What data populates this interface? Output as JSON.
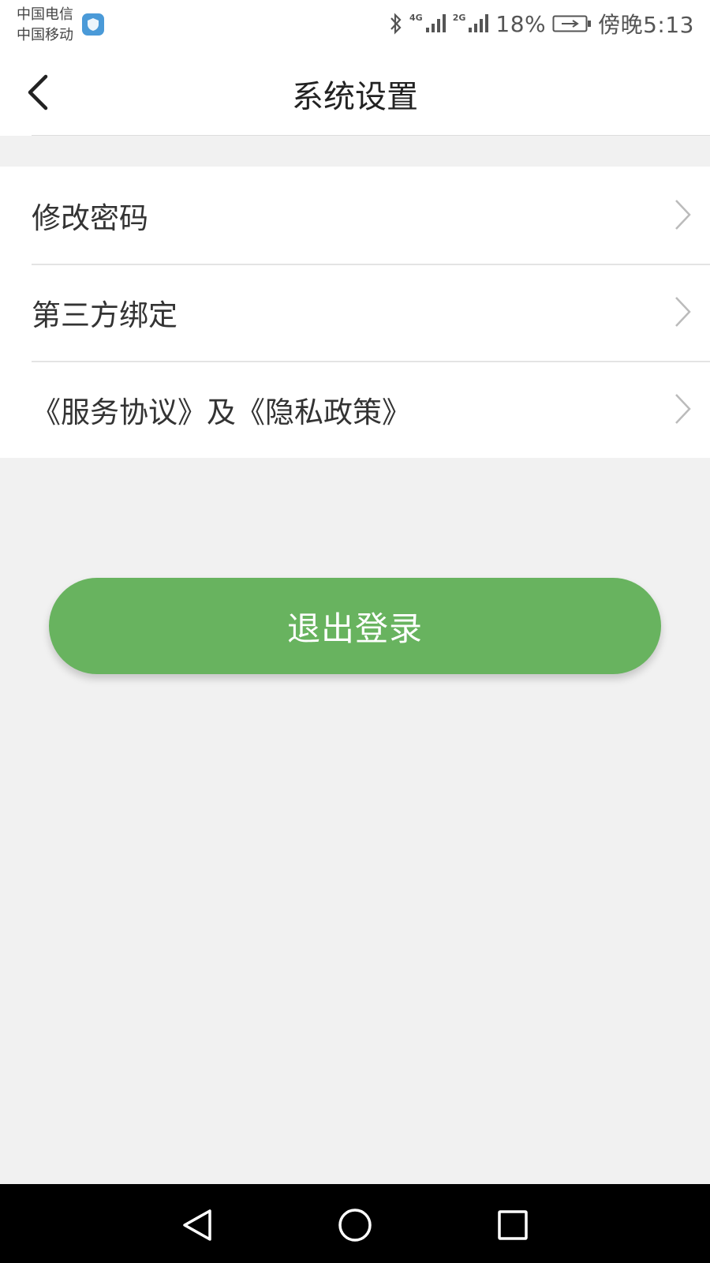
{
  "status_bar": {
    "carrier_1": "中国电信",
    "carrier_2": "中国移动",
    "shield_icon": "security-shield-icon",
    "net_1": "4G",
    "net_2": "2G",
    "battery": "18%",
    "time": "傍晚5:13"
  },
  "header": {
    "title": "系统设置",
    "back_icon": "chevron-left-icon"
  },
  "menu": {
    "items": [
      {
        "label": "修改密码"
      },
      {
        "label": "第三方绑定"
      },
      {
        "label": "《服务协议》及《隐私政策》"
      }
    ]
  },
  "actions": {
    "logout_label": "退出登录"
  },
  "nav_bar": {
    "back_icon": "triangle-back-icon",
    "home_icon": "circle-home-icon",
    "recent_icon": "square-recents-icon"
  },
  "colors": {
    "accent": "#68b35f",
    "background": "#f1f1f1",
    "surface": "#ffffff"
  }
}
